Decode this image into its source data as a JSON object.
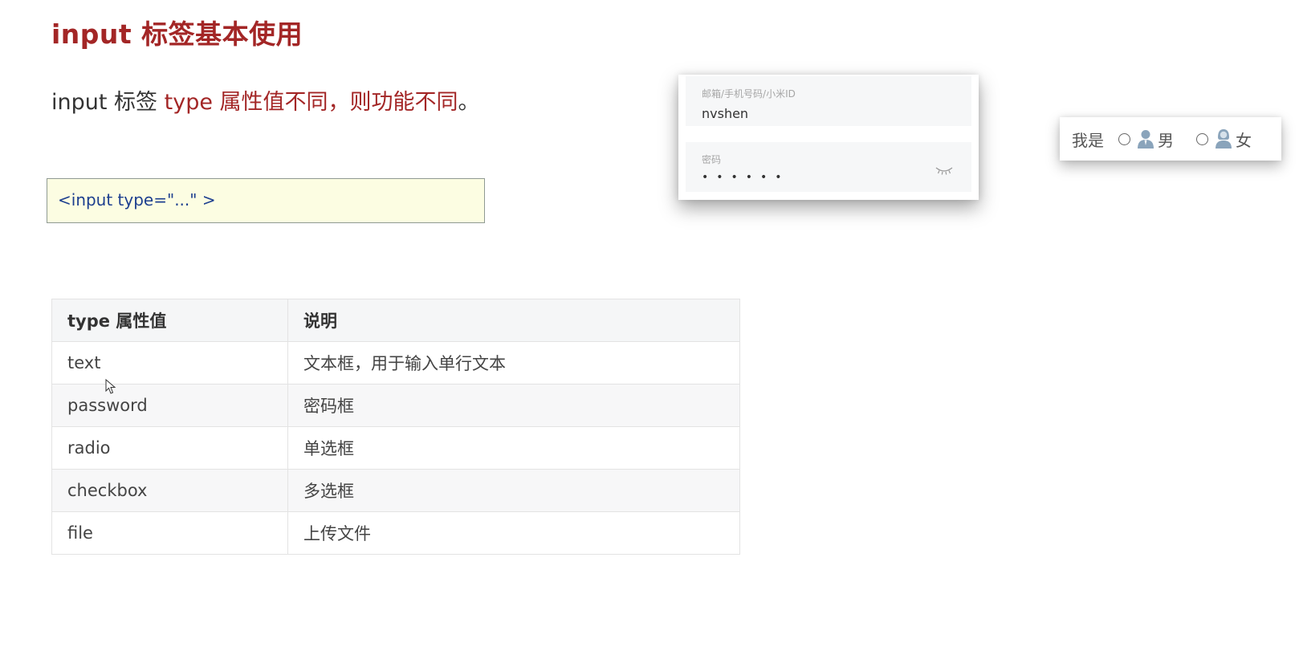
{
  "title": "input 标签基本使用",
  "intro": {
    "prefix": "input 标签 ",
    "highlight": "type 属性值不同，则功能不同",
    "suffix": "。"
  },
  "code_example": "<input type=\"...\" >",
  "table": {
    "headers": [
      "type 属性值",
      "说明"
    ],
    "rows": [
      [
        "text",
        "文本框，用于输入单行文本"
      ],
      [
        "password",
        "密码框"
      ],
      [
        "radio",
        "单选框"
      ],
      [
        "checkbox",
        "多选框"
      ],
      [
        "file",
        "上传文件"
      ]
    ]
  },
  "login_demo": {
    "username_label": "邮箱/手机号码/小米ID",
    "username_value": "nvshen",
    "password_label": "密码",
    "password_mask": "••••••"
  },
  "radio_demo": {
    "prefix": "我是",
    "option_male": "男",
    "option_female": "女"
  },
  "colors": {
    "accent": "#a32626",
    "code_bg": "#fcfde2",
    "code_text": "#1d3f8f"
  }
}
